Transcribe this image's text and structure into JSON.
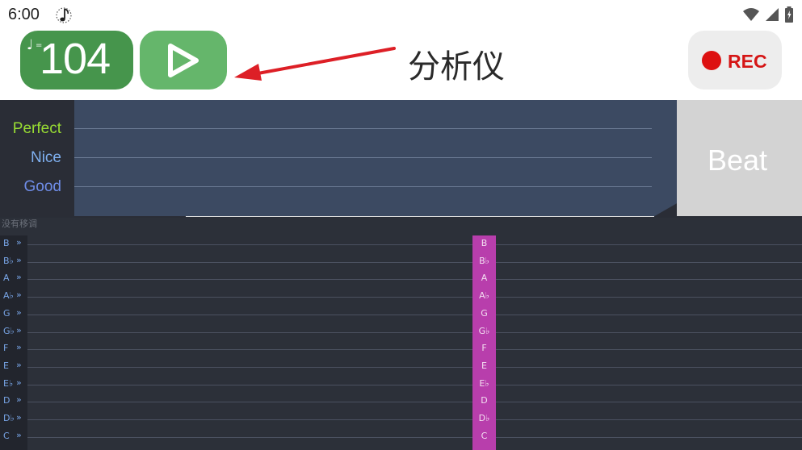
{
  "status": {
    "time": "6:00",
    "icons": [
      "metronome-note-icon",
      "wifi-icon",
      "signal-icon",
      "battery-charging-icon"
    ]
  },
  "toolbar": {
    "bpm": "104",
    "bpm_note_symbol": "♩",
    "bpm_eq_symbol": "=",
    "play_icon": "play-icon",
    "title": "分析仪",
    "rec_label": "REC",
    "colors": {
      "bpm_button": "#46954c",
      "play_button": "#65b66b",
      "rec_dot": "#dd1111",
      "annotation_arrow": "#dd1f26"
    }
  },
  "judge": {
    "labels": [
      {
        "text": "Perfect",
        "color": "#99dd33"
      },
      {
        "text": "Nice",
        "color": "#7fb0f0"
      },
      {
        "text": "Good",
        "color": "#6f8de8"
      }
    ],
    "beat_label": "Beat"
  },
  "lanes": {
    "transpose_status": "没有移调",
    "chevron": "»",
    "notes": [
      "B",
      "B♭",
      "A",
      "A♭",
      "G",
      "G♭",
      "F",
      "E",
      "E♭",
      "D",
      "D♭",
      "C"
    ]
  }
}
